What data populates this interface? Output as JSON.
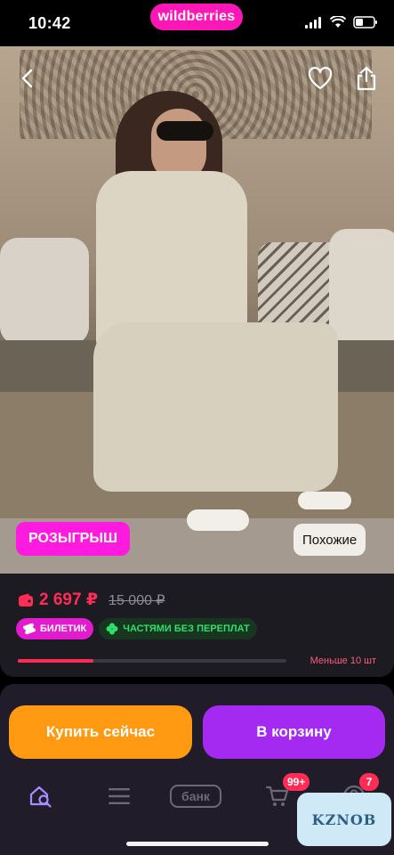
{
  "status_bar": {
    "time": "10:42",
    "brand": "wildberries",
    "icons": [
      "cellular-signal-icon",
      "wifi-icon",
      "battery-icon"
    ]
  },
  "image_controls": {
    "back_icon": "chevron-left-icon",
    "favorite_icon": "heart-icon",
    "share_icon": "share-icon"
  },
  "promo": {
    "raffle_label": "РОЗЫГРЫШ",
    "similar_label": "Похожие"
  },
  "product": {
    "price": "2 697 ₽",
    "old_price": "15 000 ₽",
    "badges": [
      {
        "label": "БИЛЕТИК",
        "icon": "ticket-icon"
      },
      {
        "label": "ЧАСТЯМИ БЕЗ ПЕРЕПЛАТ",
        "icon": "clover-icon"
      }
    ],
    "stock_text": "Меньше 10 шт",
    "stock_level": 0.28
  },
  "actions": {
    "buy_now": "Купить сейчас",
    "add_to_cart": "В корзину"
  },
  "bottom_nav": {
    "items": [
      {
        "name": "home-search",
        "icon": "search-home-icon"
      },
      {
        "name": "catalog",
        "icon": "menu-icon"
      },
      {
        "name": "bank",
        "label": "банк"
      },
      {
        "name": "cart",
        "icon": "cart-icon",
        "badge": "99+"
      },
      {
        "name": "profile",
        "icon": "profile-icon",
        "badge": "7"
      }
    ]
  },
  "watermark": "KZNOB",
  "colors": {
    "brand": "#ff16b6",
    "price": "#ff2d55",
    "buy_button": "#ff9a12",
    "cart_button": "#a42af2"
  }
}
